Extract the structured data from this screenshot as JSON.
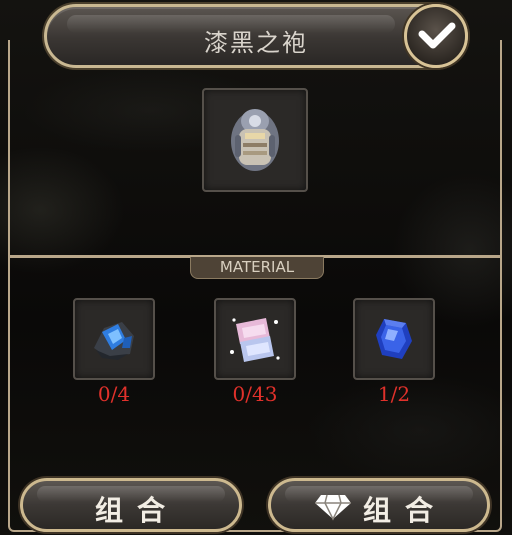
{
  "header": {
    "title": "漆黑之袍"
  },
  "result_item": {
    "name": "robe-item-icon"
  },
  "material_section": {
    "label": "MATERIAL"
  },
  "materials": [
    {
      "icon": "blue-ore-icon",
      "count": "0/4"
    },
    {
      "icon": "crystal-shard-icon",
      "count": "0/43"
    },
    {
      "icon": "sapphire-gem-icon",
      "count": "1/2"
    }
  ],
  "buttons": {
    "combine_label": "组合",
    "gem_combine_label": "组合"
  },
  "colors": {
    "frame_gold": "#b9a78a",
    "count_red": "#e0312b",
    "title_text": "#d9d4cc"
  }
}
